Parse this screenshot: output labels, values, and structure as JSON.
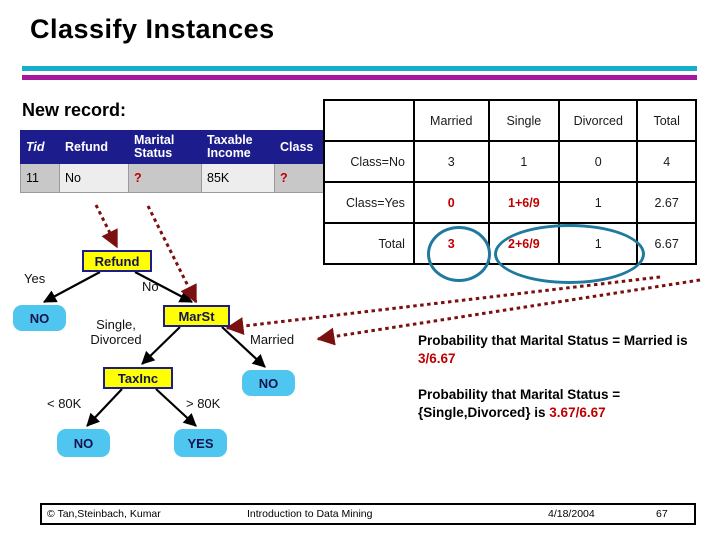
{
  "slide": {
    "title": "Classify Instances",
    "new_record_label": "New record:"
  },
  "accent_colors": {
    "divider_cyan": "#15AFCB",
    "divider_magenta": "#A5189E",
    "table_header_blue": "#1C1C8C",
    "node_yellow": "#FFFF00",
    "leaf_blue": "#4FC6F0",
    "annotation_red": "#C00000",
    "circle_teal": "#1F7A9E"
  },
  "record_table": {
    "headers": [
      "Tid",
      "Refund",
      "Marital Status",
      "Taxable Income",
      "Class"
    ],
    "rows": [
      {
        "tid": "11",
        "refund": "No",
        "marital_status": "?",
        "taxable_income": "85K",
        "class": "?"
      }
    ]
  },
  "contingency_table": {
    "columns": [
      "",
      "Married",
      "Single",
      "Divorced",
      "Total"
    ],
    "rows": [
      {
        "label": "Class=No",
        "married": "3",
        "single": "1",
        "divorced": "0",
        "total": "4"
      },
      {
        "label": "Class=Yes",
        "married": "0",
        "single": "1+6/9",
        "divorced": "1",
        "total": "2.67"
      },
      {
        "label": "Total",
        "married": "3",
        "single": "2+6/9",
        "divorced": "1",
        "total": "6.67"
      }
    ]
  },
  "tree": {
    "nodes": {
      "refund": "Refund",
      "marst": "MarSt",
      "taxinc": "TaxInc",
      "leaf_no_1": "NO",
      "leaf_no_2": "NO",
      "leaf_no_3": "NO",
      "leaf_yes": "YES"
    },
    "edge_labels": {
      "yes": "Yes",
      "no": "No",
      "single_divorced": "Single, Divorced",
      "married": "Married",
      "lt_80k": "< 80K",
      "gt_80k": "> 80K"
    }
  },
  "probabilities": {
    "married_prefix": "Probability that Marital Status = Married is ",
    "married_value": "3/6.67",
    "singledivorced_prefix": "Probability that Marital Status ={Single,Divorced} is ",
    "singledivorced_value": "3.67/6.67"
  },
  "footer": {
    "copyright": "© Tan,Steinbach, Kumar",
    "center": "Introduction to Data Mining",
    "date": "4/18/2004",
    "page": "67"
  }
}
